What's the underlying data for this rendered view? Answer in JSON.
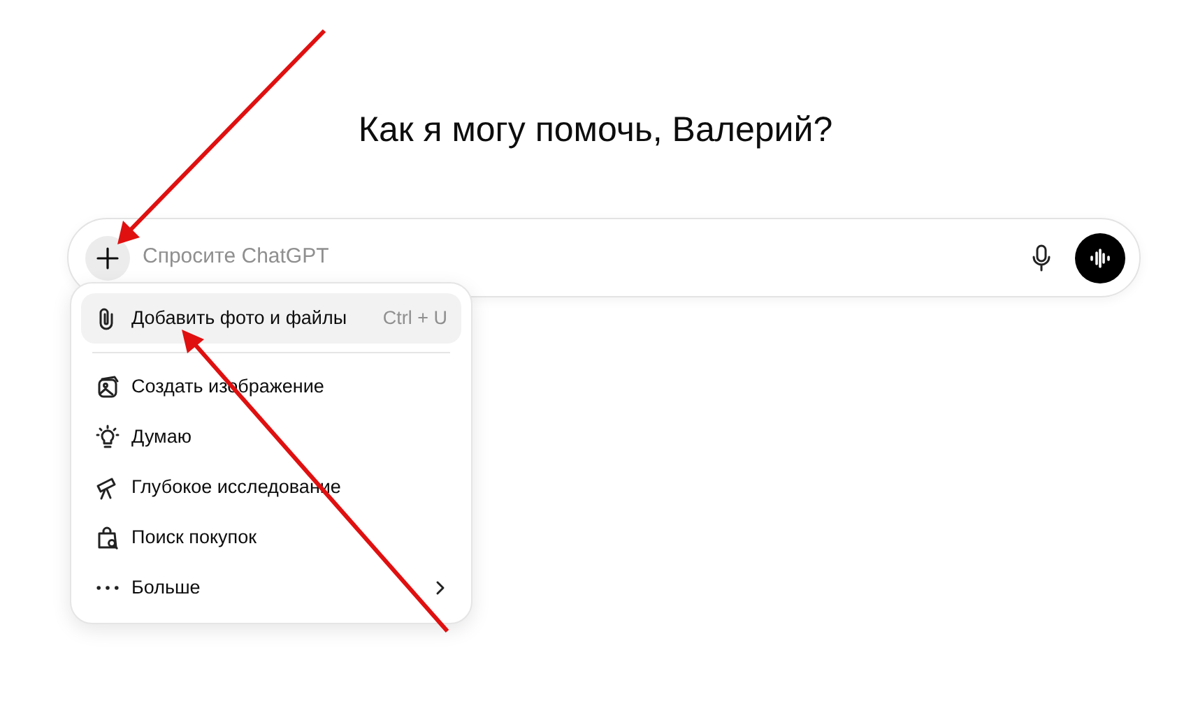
{
  "heading": "Как я могу помочь, Валерий?",
  "composer": {
    "placeholder": "Спросите ChatGPT"
  },
  "menu": {
    "items": [
      {
        "kind": "item",
        "label": "Добавить фото и файлы",
        "shortcut": "Ctrl + U",
        "selected": true
      },
      {
        "kind": "divider"
      },
      {
        "kind": "item",
        "label": "Создать изображение",
        "selected": false
      },
      {
        "kind": "item",
        "label": "Думаю",
        "selected": false
      },
      {
        "kind": "item",
        "label": "Глубокое исследование",
        "selected": false
      },
      {
        "kind": "item",
        "label": "Поиск покупок",
        "selected": false
      },
      {
        "kind": "submenu",
        "label": "Больше",
        "selected": false
      }
    ]
  }
}
